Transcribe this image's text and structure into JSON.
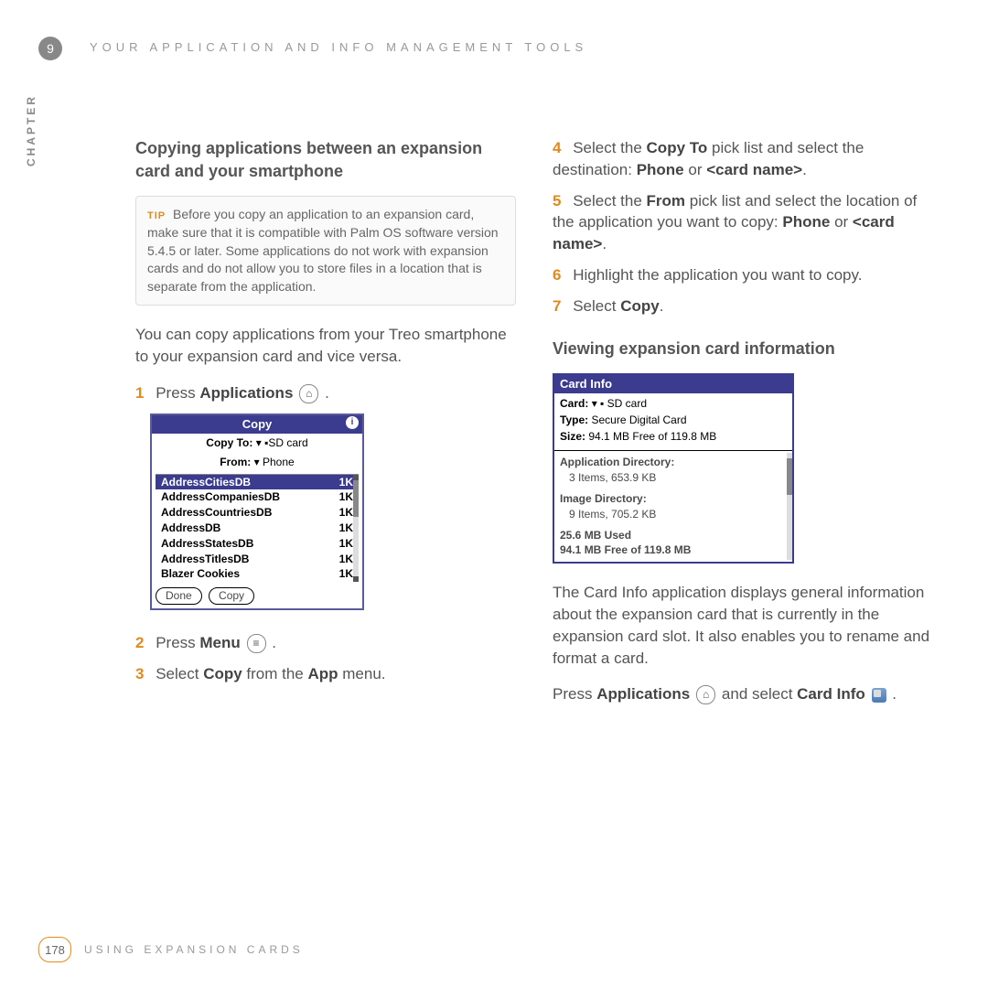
{
  "header": {
    "chapter_num": "9",
    "chapter_title": "YOUR APPLICATION AND INFO MANAGEMENT TOOLS",
    "chapter_label": "CHAPTER"
  },
  "left": {
    "h3": "Copying applications between an expansion card and your smartphone",
    "tip_label": "TIP",
    "tip_text": "Before you copy an application to an expansion card, make sure that it is compatible with Palm OS software version 5.4.5 or later. Some applications do not work with expansion cards and do not allow you to store files in a location that is separate from the application.",
    "intro": "You can copy applications from your Treo smartphone to your expansion card and vice versa.",
    "s1_num": "1",
    "s1_a": "Press ",
    "s1_b": "Applications",
    "s1_c": " .",
    "s2_num": "2",
    "s2_a": "Press ",
    "s2_b": "Menu",
    "s2_c": " .",
    "s3_num": "3",
    "s3_a": "Select ",
    "s3_b": "Copy",
    "s3_c": " from the ",
    "s3_d": "App",
    "s3_e": " menu.",
    "dlg": {
      "title": "Copy",
      "info": "i",
      "copyto_lab": "Copy To:",
      "copyto_val": "SD card",
      "from_lab": "From:",
      "from_val": "Phone",
      "items": [
        {
          "name": "AddressCitiesDB",
          "size": "1K",
          "sel": true
        },
        {
          "name": "AddressCompaniesDB",
          "size": "1K"
        },
        {
          "name": "AddressCountriesDB",
          "size": "1K"
        },
        {
          "name": "AddressDB",
          "size": "1K"
        },
        {
          "name": "AddressStatesDB",
          "size": "1K"
        },
        {
          "name": "AddressTitlesDB",
          "size": "1K"
        },
        {
          "name": "Blazer Cookies",
          "size": "1K"
        }
      ],
      "btn_done": "Done",
      "btn_copy": "Copy"
    }
  },
  "right": {
    "s4_num": "4",
    "s4_a": "Select the ",
    "s4_b": "Copy To",
    "s4_c": " pick list and select the destination: ",
    "s4_d": "Phone",
    "s4_e": " or ",
    "s4_f": "<card name>",
    "s4_g": ".",
    "s5_num": "5",
    "s5_a": "Select the ",
    "s5_b": "From",
    "s5_c": " pick list and select the location of the application you want to copy: ",
    "s5_d": "Phone",
    "s5_e": " or ",
    "s5_f": "<card name>",
    "s5_g": ".",
    "s6_num": "6",
    "s6_a": "Highlight the application you want to copy.",
    "s7_num": "7",
    "s7_a": "Select ",
    "s7_b": "Copy",
    "s7_c": ".",
    "h3b": "Viewing expansion card information",
    "dlg2": {
      "title": "Card Info",
      "card_lab": "Card:",
      "card_val": "SD card",
      "type_lab": "Type:",
      "type_val": "Secure Digital Card",
      "size_lab": "Size:",
      "size_val": "94.1 MB Free of 119.8 MB",
      "appdir_lab": "Application Directory:",
      "appdir_val": "3 Items, 653.9 KB",
      "imgdir_lab": "Image Directory:",
      "imgdir_val": "9 Items, 705.2 KB",
      "used": "25.6 MB Used",
      "free": "94.1 MB Free of 119.8 MB"
    },
    "para2": "The Card Info application displays general information about the expansion card that is currently in the expansion card slot. It also enables you to rename and format a card.",
    "press_a": "Press ",
    "press_b": "Applications",
    "press_c": " and select ",
    "press_d": "Card Info",
    "press_e": " ."
  },
  "footer": {
    "page": "178",
    "text": "USING EXPANSION CARDS"
  }
}
